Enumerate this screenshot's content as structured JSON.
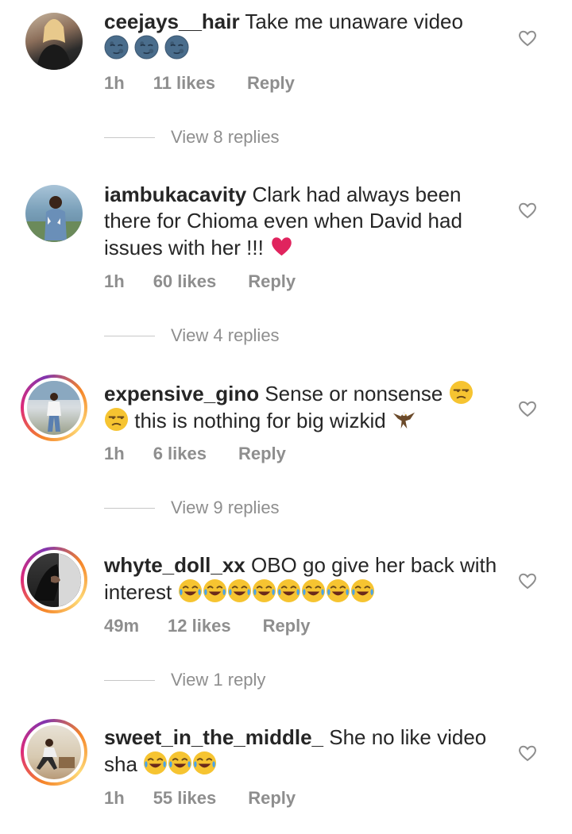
{
  "comments": [
    {
      "username": "ceejays__hair",
      "text": "Take me unaware video",
      "emojis": [
        "moon",
        "moon",
        "moon"
      ],
      "time": "1h",
      "likes": "11 likes",
      "reply": "Reply",
      "view_replies": "View 8 replies"
    },
    {
      "username": "iambukacavity",
      "text": "Clark had always been there for Chioma even when David had issues with her !!!",
      "emojis": [
        "heart"
      ],
      "time": "1h",
      "likes": "60 likes",
      "reply": "Reply",
      "view_replies": "View 4 replies"
    },
    {
      "username": "expensive_gino",
      "text_part1": "Sense or nonsense",
      "text_part2": "this is nothing for big wizkid",
      "emojis": [
        "unamused",
        "unamused",
        "eagle"
      ],
      "time": "1h",
      "likes": "6 likes",
      "reply": "Reply",
      "view_replies": "View 9 replies"
    },
    {
      "username": "whyte_doll_xx",
      "text": "OBO go give her  back with interest",
      "emojis": [
        "joy",
        "joy",
        "joy",
        "joy",
        "joy",
        "joy",
        "joy",
        "joy"
      ],
      "time": "49m",
      "likes": "12 likes",
      "reply": "Reply",
      "view_replies": "View 1 reply"
    },
    {
      "username": "sweet_in_the_middle_",
      "text": "She no like video sha",
      "emojis": [
        "joy",
        "joy",
        "joy"
      ],
      "time": "1h",
      "likes": "55 likes",
      "reply": "Reply"
    }
  ],
  "colors": {
    "text": "#262626",
    "meta": "#8e8e8e",
    "divider": "#c7c7c7"
  }
}
